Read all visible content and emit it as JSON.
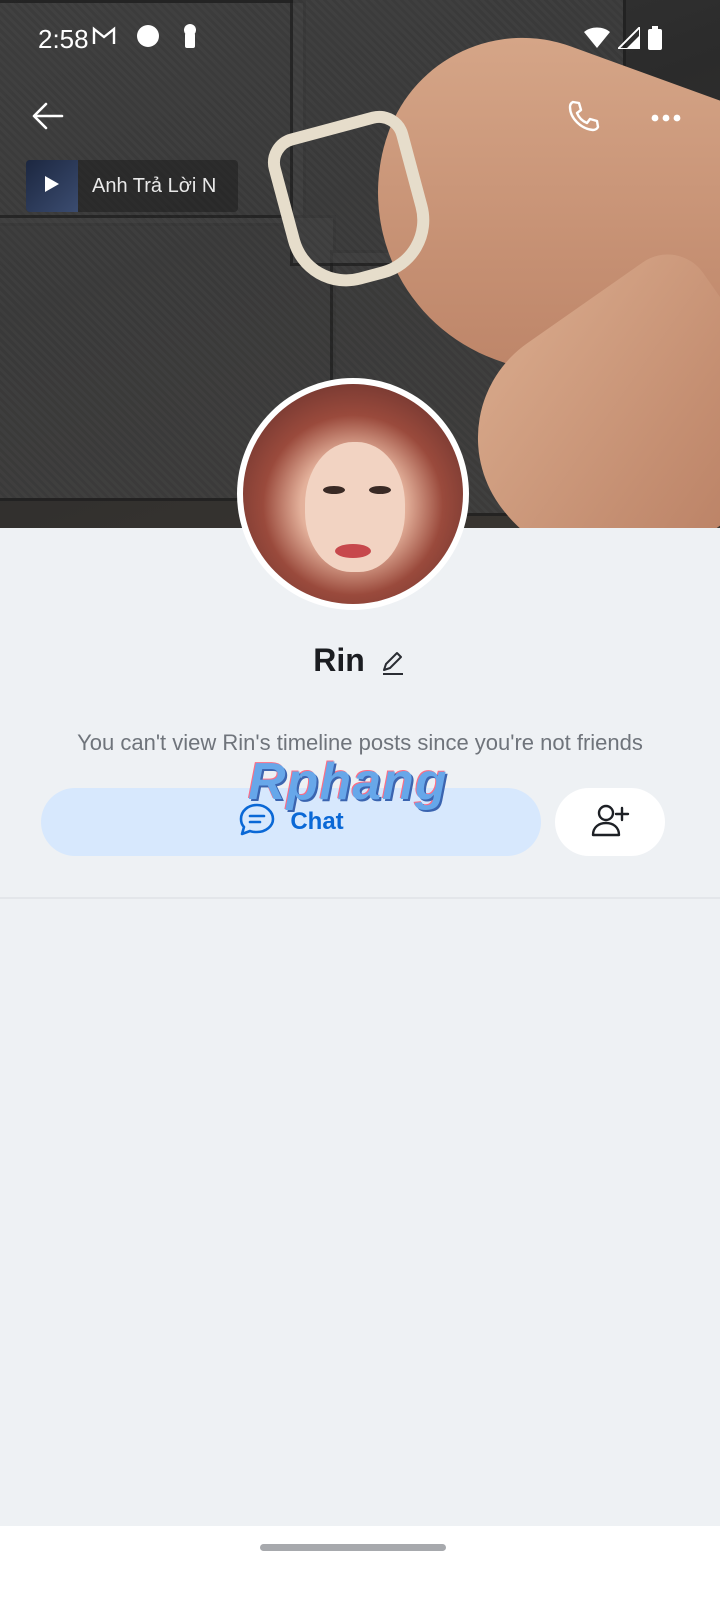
{
  "status_bar": {
    "time": "2:58",
    "icons": [
      "gmail-icon",
      "circle-notification-icon",
      "keyhole-icon",
      "wifi-icon",
      "signal-icon",
      "battery-icon"
    ]
  },
  "header": {
    "icons": [
      "back-arrow-icon",
      "phone-icon",
      "more-options-icon"
    ]
  },
  "music": {
    "title": "Anh Trả Lời N",
    "icon": "play-icon"
  },
  "profile": {
    "name": "Rin",
    "edit_icon": "pencil-icon"
  },
  "notice": {
    "text": "You can't view Rin's timeline posts since you're not friends"
  },
  "actions": {
    "chat_label": "Chat",
    "chat_icon": "chat-bubble-icon",
    "add_friend_icon": "add-friend-icon"
  },
  "watermark": {
    "text": "Rphang"
  },
  "colors": {
    "page_background": "#eef1f4",
    "chat_button_background": "#d7e8fd",
    "chat_accent": "#0a68d6",
    "notice_text": "#6f747b",
    "name_text": "#1b1d21"
  }
}
